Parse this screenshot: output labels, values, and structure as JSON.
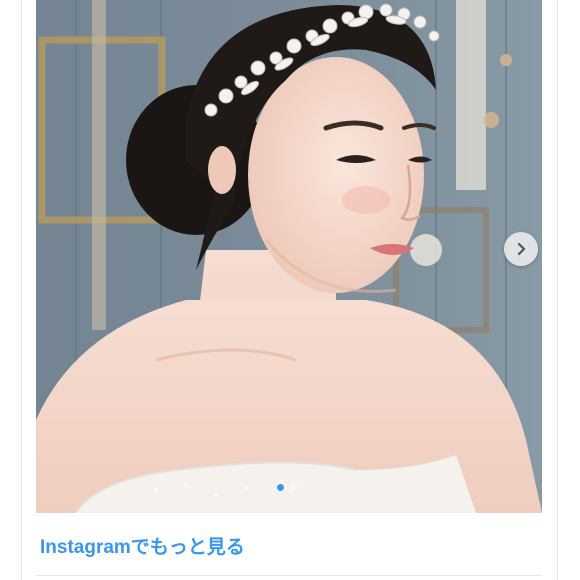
{
  "post": {
    "image_alt": "",
    "more_link_label": "Instagramでもっと見る",
    "carousel": {
      "current_index": 1,
      "total_indicators": 2
    },
    "colors": {
      "link": "#3897f0",
      "active_dot": "#3897f0"
    },
    "icons": {
      "next": "chevron-right-icon"
    }
  }
}
